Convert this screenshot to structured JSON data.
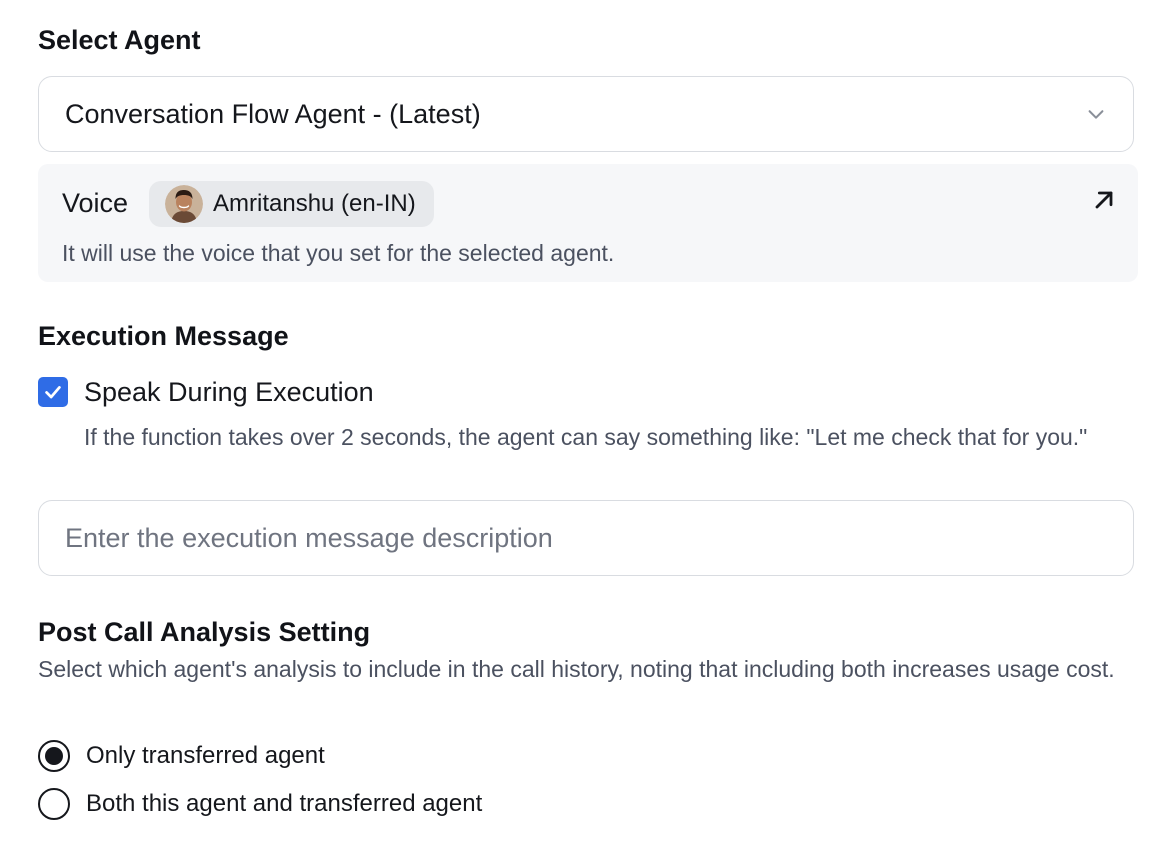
{
  "select_agent": {
    "title": "Select Agent",
    "selected_value": "Conversation Flow Agent - (Latest)"
  },
  "voice": {
    "label": "Voice",
    "name": "Amritanshu (en-IN)",
    "help": "It will use the voice that you set for the selected agent."
  },
  "execution_message": {
    "title": "Execution Message",
    "checkbox_label": "Speak During Execution",
    "checkbox_checked": true,
    "help": "If the function takes over 2 seconds, the agent can say something like: \"Let me check that for you.\"",
    "input_placeholder": "Enter the execution message description",
    "input_value": ""
  },
  "post_call_analysis": {
    "title": "Post Call Analysis Setting",
    "help": "Select which agent's analysis to include in the call history, noting that including both increases usage cost.",
    "options": [
      {
        "label": "Only transferred agent",
        "selected": true
      },
      {
        "label": "Both this agent and transferred agent",
        "selected": false
      }
    ]
  },
  "colors": {
    "checkbox_accent": "#2f6ce6",
    "panel_background": "#f6f7f9",
    "chip_background": "#e7e9ec",
    "border": "#d9dce1"
  },
  "icons": {
    "dropdown": "chevron-down-icon",
    "open_voice": "arrow-up-right-icon",
    "checkbox": "check-icon"
  }
}
